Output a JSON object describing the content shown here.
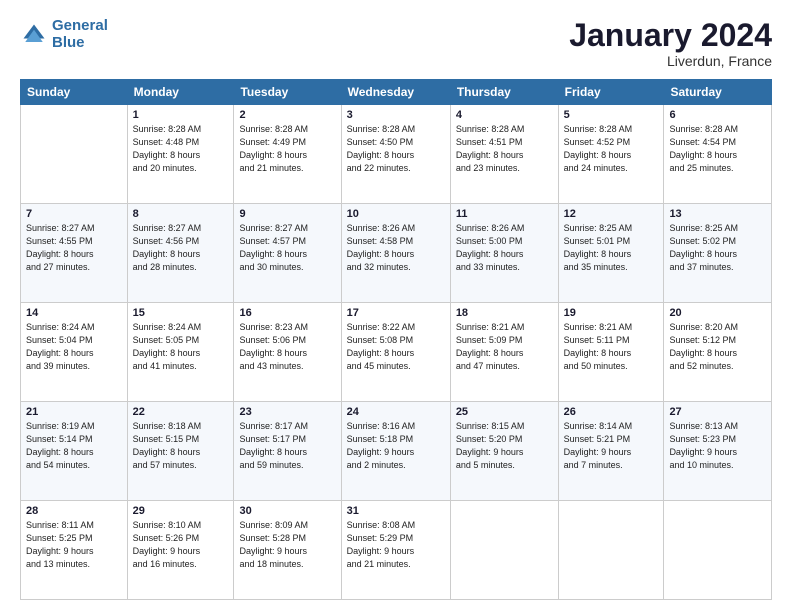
{
  "header": {
    "logo_line1": "General",
    "logo_line2": "Blue",
    "month": "January 2024",
    "location": "Liverdun, France"
  },
  "weekdays": [
    "Sunday",
    "Monday",
    "Tuesday",
    "Wednesday",
    "Thursday",
    "Friday",
    "Saturday"
  ],
  "weeks": [
    [
      {
        "day": "",
        "info": ""
      },
      {
        "day": "1",
        "info": "Sunrise: 8:28 AM\nSunset: 4:48 PM\nDaylight: 8 hours\nand 20 minutes."
      },
      {
        "day": "2",
        "info": "Sunrise: 8:28 AM\nSunset: 4:49 PM\nDaylight: 8 hours\nand 21 minutes."
      },
      {
        "day": "3",
        "info": "Sunrise: 8:28 AM\nSunset: 4:50 PM\nDaylight: 8 hours\nand 22 minutes."
      },
      {
        "day": "4",
        "info": "Sunrise: 8:28 AM\nSunset: 4:51 PM\nDaylight: 8 hours\nand 23 minutes."
      },
      {
        "day": "5",
        "info": "Sunrise: 8:28 AM\nSunset: 4:52 PM\nDaylight: 8 hours\nand 24 minutes."
      },
      {
        "day": "6",
        "info": "Sunrise: 8:28 AM\nSunset: 4:54 PM\nDaylight: 8 hours\nand 25 minutes."
      }
    ],
    [
      {
        "day": "7",
        "info": "Sunrise: 8:27 AM\nSunset: 4:55 PM\nDaylight: 8 hours\nand 27 minutes."
      },
      {
        "day": "8",
        "info": "Sunrise: 8:27 AM\nSunset: 4:56 PM\nDaylight: 8 hours\nand 28 minutes."
      },
      {
        "day": "9",
        "info": "Sunrise: 8:27 AM\nSunset: 4:57 PM\nDaylight: 8 hours\nand 30 minutes."
      },
      {
        "day": "10",
        "info": "Sunrise: 8:26 AM\nSunset: 4:58 PM\nDaylight: 8 hours\nand 32 minutes."
      },
      {
        "day": "11",
        "info": "Sunrise: 8:26 AM\nSunset: 5:00 PM\nDaylight: 8 hours\nand 33 minutes."
      },
      {
        "day": "12",
        "info": "Sunrise: 8:25 AM\nSunset: 5:01 PM\nDaylight: 8 hours\nand 35 minutes."
      },
      {
        "day": "13",
        "info": "Sunrise: 8:25 AM\nSunset: 5:02 PM\nDaylight: 8 hours\nand 37 minutes."
      }
    ],
    [
      {
        "day": "14",
        "info": "Sunrise: 8:24 AM\nSunset: 5:04 PM\nDaylight: 8 hours\nand 39 minutes."
      },
      {
        "day": "15",
        "info": "Sunrise: 8:24 AM\nSunset: 5:05 PM\nDaylight: 8 hours\nand 41 minutes."
      },
      {
        "day": "16",
        "info": "Sunrise: 8:23 AM\nSunset: 5:06 PM\nDaylight: 8 hours\nand 43 minutes."
      },
      {
        "day": "17",
        "info": "Sunrise: 8:22 AM\nSunset: 5:08 PM\nDaylight: 8 hours\nand 45 minutes."
      },
      {
        "day": "18",
        "info": "Sunrise: 8:21 AM\nSunset: 5:09 PM\nDaylight: 8 hours\nand 47 minutes."
      },
      {
        "day": "19",
        "info": "Sunrise: 8:21 AM\nSunset: 5:11 PM\nDaylight: 8 hours\nand 50 minutes."
      },
      {
        "day": "20",
        "info": "Sunrise: 8:20 AM\nSunset: 5:12 PM\nDaylight: 8 hours\nand 52 minutes."
      }
    ],
    [
      {
        "day": "21",
        "info": "Sunrise: 8:19 AM\nSunset: 5:14 PM\nDaylight: 8 hours\nand 54 minutes."
      },
      {
        "day": "22",
        "info": "Sunrise: 8:18 AM\nSunset: 5:15 PM\nDaylight: 8 hours\nand 57 minutes."
      },
      {
        "day": "23",
        "info": "Sunrise: 8:17 AM\nSunset: 5:17 PM\nDaylight: 8 hours\nand 59 minutes."
      },
      {
        "day": "24",
        "info": "Sunrise: 8:16 AM\nSunset: 5:18 PM\nDaylight: 9 hours\nand 2 minutes."
      },
      {
        "day": "25",
        "info": "Sunrise: 8:15 AM\nSunset: 5:20 PM\nDaylight: 9 hours\nand 5 minutes."
      },
      {
        "day": "26",
        "info": "Sunrise: 8:14 AM\nSunset: 5:21 PM\nDaylight: 9 hours\nand 7 minutes."
      },
      {
        "day": "27",
        "info": "Sunrise: 8:13 AM\nSunset: 5:23 PM\nDaylight: 9 hours\nand 10 minutes."
      }
    ],
    [
      {
        "day": "28",
        "info": "Sunrise: 8:11 AM\nSunset: 5:25 PM\nDaylight: 9 hours\nand 13 minutes."
      },
      {
        "day": "29",
        "info": "Sunrise: 8:10 AM\nSunset: 5:26 PM\nDaylight: 9 hours\nand 16 minutes."
      },
      {
        "day": "30",
        "info": "Sunrise: 8:09 AM\nSunset: 5:28 PM\nDaylight: 9 hours\nand 18 minutes."
      },
      {
        "day": "31",
        "info": "Sunrise: 8:08 AM\nSunset: 5:29 PM\nDaylight: 9 hours\nand 21 minutes."
      },
      {
        "day": "",
        "info": ""
      },
      {
        "day": "",
        "info": ""
      },
      {
        "day": "",
        "info": ""
      }
    ]
  ]
}
